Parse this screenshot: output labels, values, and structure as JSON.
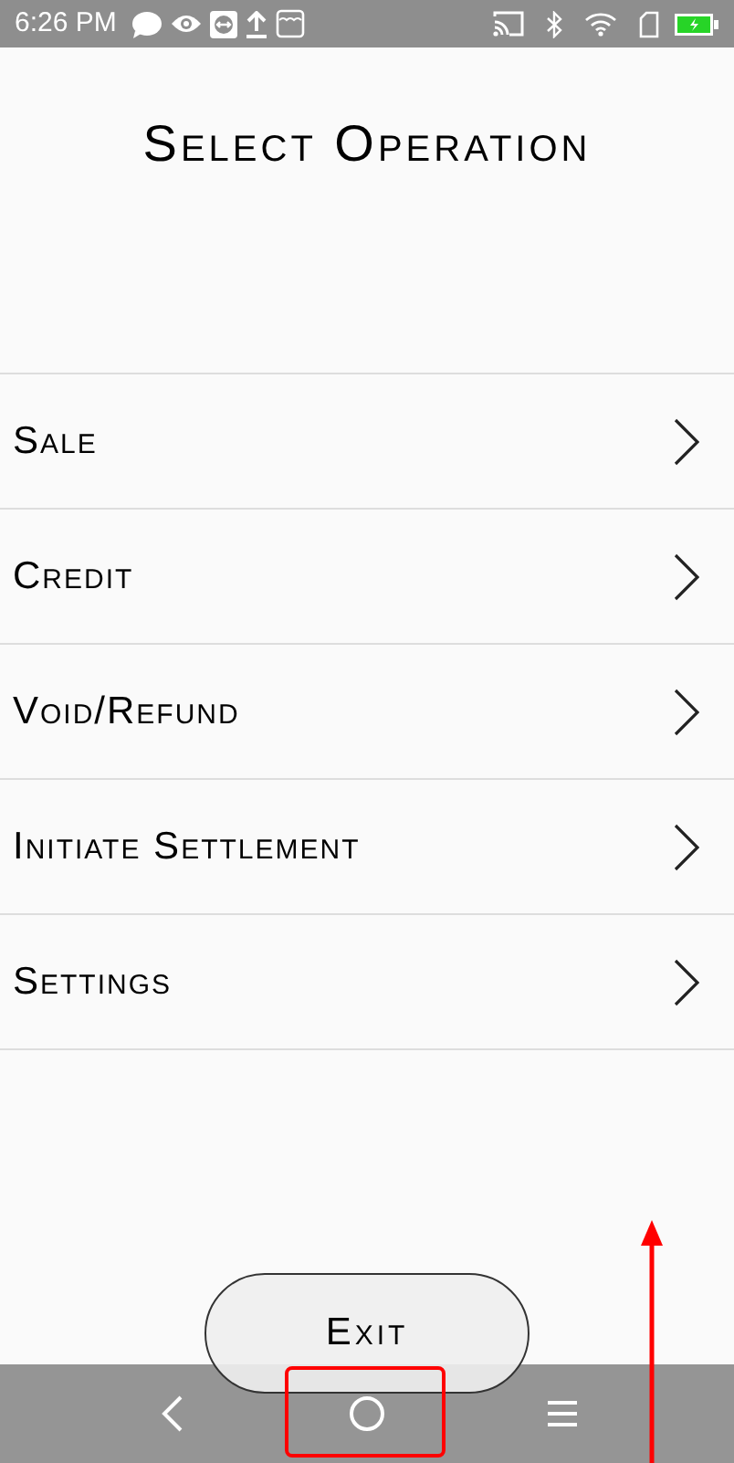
{
  "status_bar": {
    "time": "6:26 PM"
  },
  "title": "Select Operation",
  "items": [
    {
      "label": "Sale"
    },
    {
      "label": "Credit"
    },
    {
      "label": "Void/Refund"
    },
    {
      "label": "Initiate Settlement"
    },
    {
      "label": "Settings"
    }
  ],
  "exit_button": "Exit"
}
